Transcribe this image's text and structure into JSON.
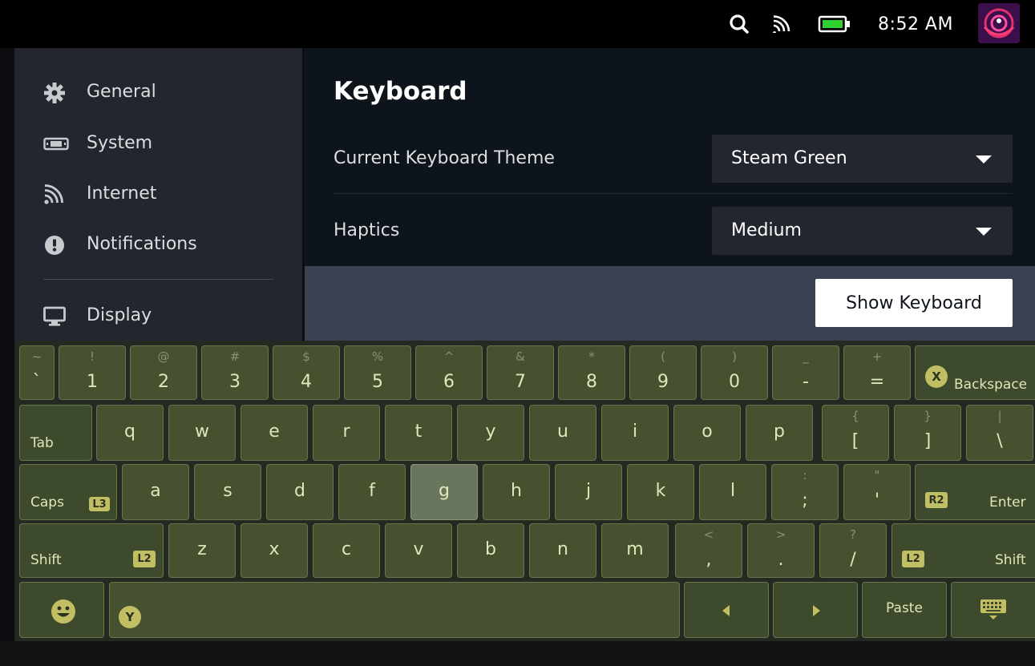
{
  "status_bar": {
    "time": "8:52 AM",
    "icons": [
      "search-icon",
      "wifi-icon",
      "battery-icon"
    ],
    "battery_color": "#2fd12f"
  },
  "sidebar": {
    "items": [
      {
        "label": "General",
        "icon": "gear-icon"
      },
      {
        "label": "System",
        "icon": "system-icon"
      },
      {
        "label": "Internet",
        "icon": "wifi-icon"
      },
      {
        "label": "Notifications",
        "icon": "alert-icon"
      },
      {
        "label": "Display",
        "icon": "monitor-icon"
      }
    ]
  },
  "main": {
    "title": "Keyboard",
    "rows": [
      {
        "label": "Current Keyboard Theme",
        "value": "Steam Green"
      },
      {
        "label": "Haptics",
        "value": "Medium"
      }
    ],
    "show_keyboard_label": "Show Keyboard"
  },
  "keyboard": {
    "theme_color": "#45512f",
    "number_row": [
      {
        "shift": "~",
        "main": "`"
      },
      {
        "shift": "!",
        "main": "1"
      },
      {
        "shift": "@",
        "main": "2"
      },
      {
        "shift": "#",
        "main": "3"
      },
      {
        "shift": "$",
        "main": "4"
      },
      {
        "shift": "%",
        "main": "5"
      },
      {
        "shift": "^",
        "main": "6"
      },
      {
        "shift": "&",
        "main": "7"
      },
      {
        "shift": "*",
        "main": "8"
      },
      {
        "shift": "(",
        "main": "9"
      },
      {
        "shift": ")",
        "main": "0"
      },
      {
        "shift": "_",
        "main": "-"
      },
      {
        "shift": "+",
        "main": "="
      }
    ],
    "backspace": {
      "label": "Backspace",
      "button": "X"
    },
    "tab_label": "Tab",
    "q_row": [
      "q",
      "w",
      "e",
      "r",
      "t",
      "y",
      "u",
      "i",
      "o",
      "p"
    ],
    "q_row_sym": [
      {
        "shift": "{",
        "main": "["
      },
      {
        "shift": "}",
        "main": "]"
      },
      {
        "shift": "|",
        "main": "\\"
      }
    ],
    "caps": {
      "label": "Caps",
      "button": "L3"
    },
    "a_row": [
      "a",
      "s",
      "d",
      "f",
      "g",
      "h",
      "j",
      "k",
      "l"
    ],
    "a_row_sym": [
      {
        "shift": ":",
        "main": ";"
      },
      {
        "shift": "\"",
        "main": "'"
      }
    ],
    "enter": {
      "label": "Enter",
      "button": "R2"
    },
    "shift_left": {
      "label": "Shift",
      "button": "L2"
    },
    "z_row": [
      "z",
      "x",
      "c",
      "v",
      "b",
      "n",
      "m"
    ],
    "z_row_sym": [
      {
        "shift": "<",
        "main": ","
      },
      {
        "shift": ">",
        "main": "."
      },
      {
        "shift": "?",
        "main": "/"
      }
    ],
    "shift_right": {
      "label": "Shift",
      "button": "L2"
    },
    "space_button": "Y",
    "paste_label": "Paste",
    "highlighted_key": "g"
  }
}
